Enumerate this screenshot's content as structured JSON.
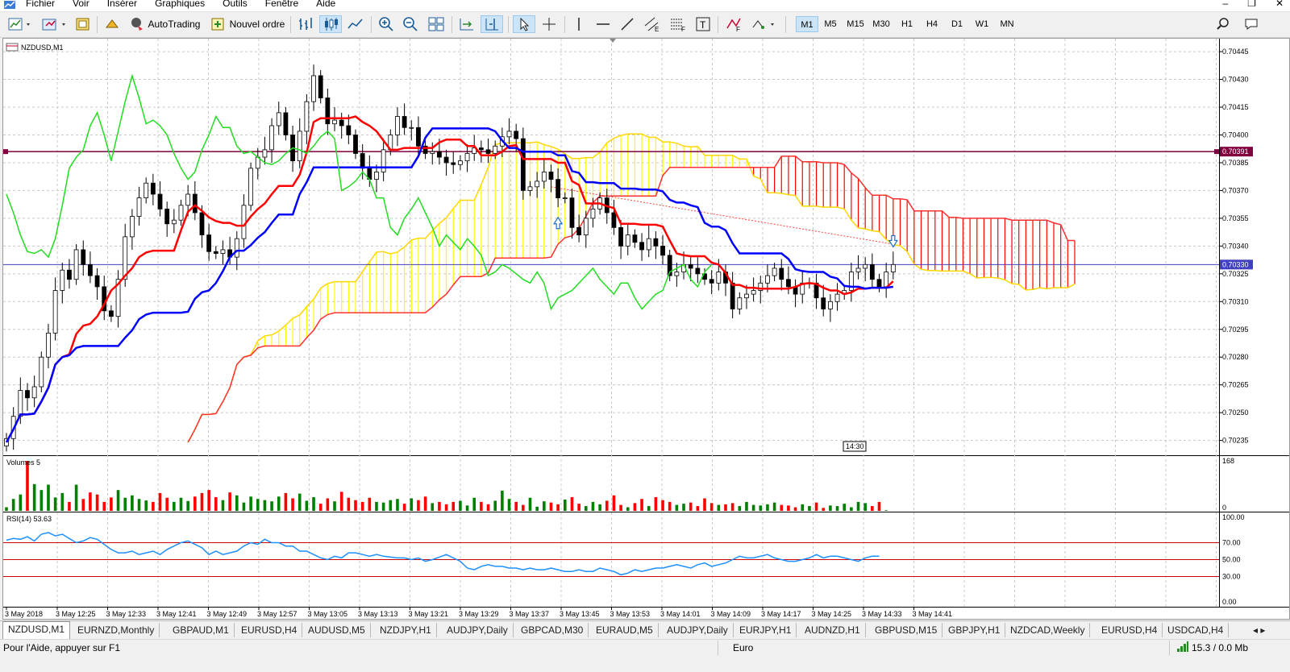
{
  "menu": [
    "Fichier",
    "Voir",
    "Insérer",
    "Graphiques",
    "Outils",
    "Fenêtre",
    "Aide"
  ],
  "toolbar": {
    "autotrading_label": "AutoTrading",
    "new_order_label": "Nouvel ordre",
    "timeframes": [
      "M1",
      "M5",
      "M15",
      "M30",
      "H1",
      "H4",
      "D1",
      "W1",
      "MN"
    ],
    "active_timeframe": "M1"
  },
  "chart": {
    "symbol_label": "NZDUSD,M1",
    "price_labels": [
      "0.70445",
      "0.70430",
      "0.70415",
      "0.70400",
      "0.70385",
      "0.70370",
      "0.70355",
      "0.70340",
      "0.70325",
      "0.70310",
      "0.70295",
      "0.70280",
      "0.70265",
      "0.70250",
      "0.70235"
    ],
    "hline_price_1": "0.70391",
    "hline_price_2": "0.70330",
    "cursor_time_tag": "14:30",
    "volumes_label": "Volumes 5",
    "volumes_max": "168",
    "volumes_min": "0",
    "rsi_label": "RSI(14) 53.63",
    "rsi_levels": [
      "100.00",
      "70.00",
      "50.00",
      "30.00",
      "0.00"
    ],
    "time_labels": [
      "3 May 2018",
      "3 May 12:25",
      "3 May 12:33",
      "3 May 12:41",
      "3 May 12:49",
      "3 May 12:57",
      "3 May 13:05",
      "3 May 13:13",
      "3 May 13:21",
      "3 May 13:29",
      "3 May 13:37",
      "3 May 13:45",
      "3 May 13:53",
      "3 May 14:01",
      "3 May 14:09",
      "3 May 14:17",
      "3 May 14:25",
      "3 May 14:33",
      "3 May 14:41"
    ],
    "colors": {
      "bull": "#000000",
      "tenkan": "#ff0000",
      "kijun": "#0000ff",
      "chikou": "#00ff00",
      "kumo_up": "#ffff00",
      "kumo_down": "#ff0000",
      "vol_up": "#008000",
      "vol_down": "#ff0000",
      "rsi": "#1e90ff",
      "hline1": "#800040",
      "hline2": "#4040c0"
    }
  },
  "chart_data": {
    "type": "line",
    "title": "NZDUSD,M1",
    "ylim": [
      0.70227,
      0.70452
    ],
    "close": [
      0.70236,
      0.70248,
      0.70262,
      0.70258,
      0.70264,
      0.7028,
      0.70293,
      0.70316,
      0.70327,
      0.70322,
      0.70338,
      0.7033,
      0.70324,
      0.70318,
      0.70305,
      0.70302,
      0.70322,
      0.70345,
      0.70356,
      0.70366,
      0.70374,
      0.70368,
      0.7036,
      0.70352,
      0.70354,
      0.70362,
      0.70368,
      0.70358,
      0.70346,
      0.70337,
      0.70336,
      0.70338,
      0.70334,
      0.70344,
      0.70362,
      0.70382,
      0.70388,
      0.70392,
      0.70405,
      0.70412,
      0.704,
      0.70386,
      0.70402,
      0.70418,
      0.70432,
      0.7042,
      0.70406,
      0.70408,
      0.70405,
      0.704,
      0.7039,
      0.70382,
      0.70376,
      0.7038,
      0.70392,
      0.704,
      0.7041,
      0.70404,
      0.70404,
      0.70394,
      0.7039,
      0.70391,
      0.70388,
      0.70385,
      0.70384,
      0.70386,
      0.7039,
      0.70393,
      0.70392,
      0.7039,
      0.70394,
      0.70399,
      0.70402,
      0.70398,
      0.7037,
      0.70372,
      0.70375,
      0.7038,
      0.70376,
      0.70366,
      0.70366,
      0.7035,
      0.70346,
      0.70355,
      0.7036,
      0.70366,
      0.70358,
      0.7035,
      0.7034,
      0.70346,
      0.70342,
      0.70338,
      0.70344,
      0.7034,
      0.70335,
      0.70324,
      0.70326,
      0.7033,
      0.70328,
      0.70325,
      0.70322,
      0.7032,
      0.70326,
      0.7032,
      0.70306,
      0.70312,
      0.70314,
      0.70316,
      0.7032,
      0.70324,
      0.70328,
      0.70322,
      0.70318,
      0.70314,
      0.7032,
      0.7032,
      0.70312,
      0.70306,
      0.7031,
      0.70314,
      0.70316,
      0.70326,
      0.70328,
      0.7033,
      0.70322,
      0.70318,
      0.70326,
      0.7033
    ],
    "volume": [
      12,
      40,
      55,
      168,
      90,
      70,
      88,
      45,
      60,
      30,
      88,
      40,
      62,
      55,
      30,
      45,
      70,
      44,
      52,
      40,
      35,
      30,
      60,
      44,
      30,
      44,
      33,
      48,
      60,
      70,
      46,
      36,
      62,
      52,
      28,
      48,
      40,
      36,
      32,
      48,
      60,
      42,
      58,
      34,
      46,
      24,
      42,
      32,
      64,
      44,
      36,
      30,
      44,
      30,
      28,
      36,
      40,
      24,
      42,
      36,
      48,
      26,
      30,
      22,
      30,
      34,
      18,
      44,
      30,
      22,
      34,
      68,
      40,
      30,
      20,
      44,
      14,
      32,
      28,
      22,
      38,
      46,
      24,
      16,
      30,
      22,
      34,
      52,
      20,
      12,
      26,
      40,
      16,
      46,
      36,
      30,
      20,
      24,
      28,
      16,
      42,
      26,
      20,
      22,
      26,
      16,
      30,
      20,
      18,
      22,
      28,
      20,
      18,
      12,
      22,
      16,
      28,
      10,
      18,
      16,
      24,
      12,
      30,
      26,
      16,
      30,
      2
    ],
    "rsi": [
      73,
      75,
      74,
      77,
      72,
      80,
      82,
      78,
      80,
      75,
      70,
      72,
      76,
      74,
      68,
      62,
      58,
      58,
      60,
      56,
      58,
      60,
      56,
      62,
      66,
      70,
      72,
      68,
      64,
      56,
      60,
      56,
      58,
      60,
      66,
      70,
      68,
      74,
      70,
      70,
      66,
      66,
      60,
      60,
      56,
      52,
      50,
      54,
      52,
      58,
      58,
      56,
      54,
      56,
      54,
      53,
      52,
      52,
      50,
      52,
      48,
      50,
      53,
      56,
      52,
      48,
      40,
      38,
      42,
      44,
      42,
      42,
      40,
      40,
      38,
      40,
      38,
      38,
      40,
      38,
      36,
      36,
      38,
      36,
      36,
      40,
      38,
      36,
      32,
      34,
      38,
      36,
      38,
      40,
      40,
      42,
      44,
      42,
      40,
      44,
      46,
      42,
      44,
      46,
      50,
      54,
      52,
      52,
      54,
      56,
      52,
      50,
      48,
      48,
      50,
      52,
      56,
      52,
      54,
      54,
      52,
      50,
      48,
      52,
      54,
      54
    ]
  },
  "tabs": [
    "NZDUSD,M1",
    "EURNZD,Monthly",
    "GBPAUD,M1",
    "EURUSD,H4",
    "AUDUSD,M5",
    "NZDJPY,H1",
    "AUDJPY,Daily",
    "GBPCAD,M30",
    "EURAUD,M5",
    "AUDJPY,Daily",
    "EURJPY,H1",
    "AUDNZD,H1",
    "GBPUSD,M15",
    "GBPJPY,H1",
    "NZDCAD,Weekly",
    "EURUSD,H4",
    "USDCAD,H4"
  ],
  "status": {
    "help": "Pour l'Aide, appuyer sur F1",
    "profile": "Euro",
    "traffic": "15.3 / 0.0 Mb"
  }
}
